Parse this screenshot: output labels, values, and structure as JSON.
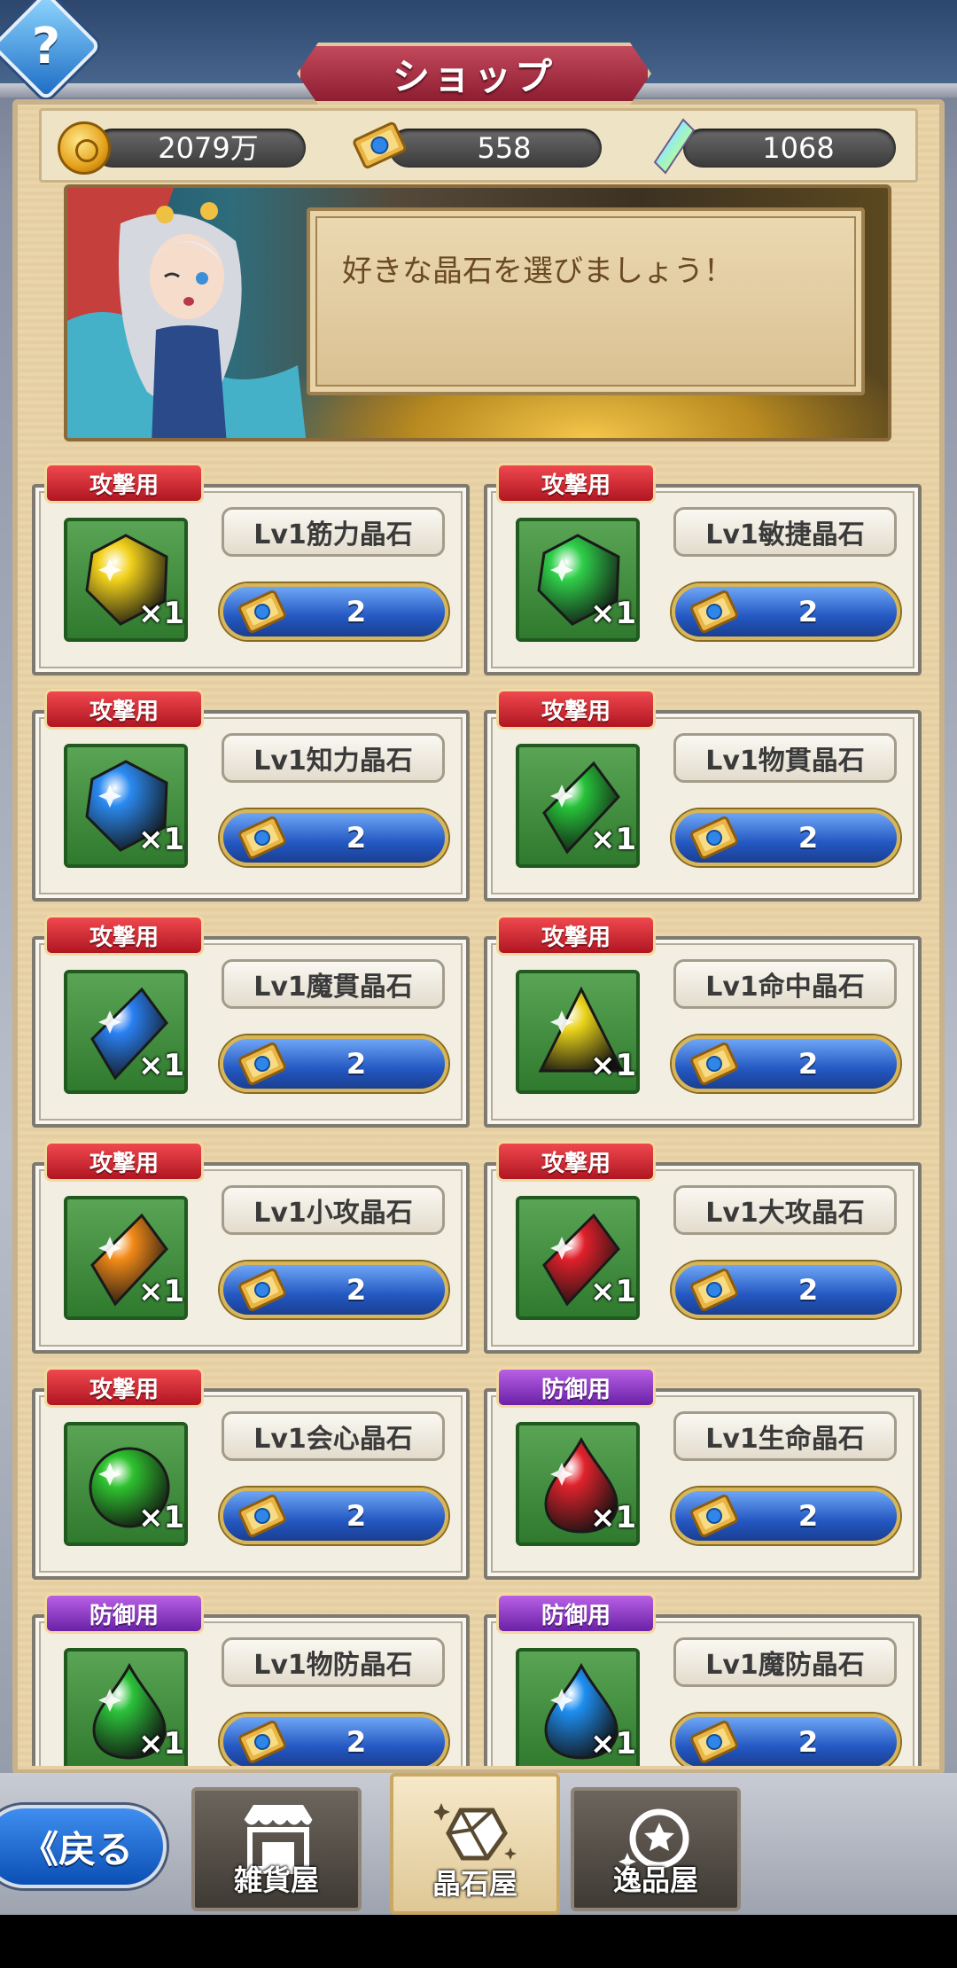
{
  "header": {
    "title": "ショップ",
    "help_glyph": "?"
  },
  "currency": {
    "gold": "2079万",
    "tickets": "558",
    "crystals": "1068"
  },
  "banner": {
    "message": "好きな晶石を選びましょう！"
  },
  "items": [
    {
      "category": "攻撃用",
      "type": "attack",
      "name": "Lv1筋力晶石",
      "qty": "×1",
      "price": "2",
      "gem_color": "#f2d21c",
      "gem_shape": "pentagon"
    },
    {
      "category": "攻撃用",
      "type": "attack",
      "name": "Lv1敏捷晶石",
      "qty": "×1",
      "price": "2",
      "gem_color": "#2fcf4a",
      "gem_shape": "pentagon"
    },
    {
      "category": "攻撃用",
      "type": "attack",
      "name": "Lv1知力晶石",
      "qty": "×1",
      "price": "2",
      "gem_color": "#2b8af0",
      "gem_shape": "pentagon"
    },
    {
      "category": "攻撃用",
      "type": "attack",
      "name": "Lv1物貫晶石",
      "qty": "×1",
      "price": "2",
      "gem_color": "#27c23a",
      "gem_shape": "rhombus"
    },
    {
      "category": "攻撃用",
      "type": "attack",
      "name": "Lv1魔貫晶石",
      "qty": "×1",
      "price": "2",
      "gem_color": "#2a80f2",
      "gem_shape": "rhombus"
    },
    {
      "category": "攻撃用",
      "type": "attack",
      "name": "Lv1命中晶石",
      "qty": "×1",
      "price": "2",
      "gem_color": "#e8d21a",
      "gem_shape": "triangle"
    },
    {
      "category": "攻撃用",
      "type": "attack",
      "name": "Lv1小攻晶石",
      "qty": "×1",
      "price": "2",
      "gem_color": "#f38a18",
      "gem_shape": "rhombus"
    },
    {
      "category": "攻撃用",
      "type": "attack",
      "name": "Lv1大攻晶石",
      "qty": "×1",
      "price": "2",
      "gem_color": "#e0202a",
      "gem_shape": "rhombus"
    },
    {
      "category": "攻撃用",
      "type": "attack",
      "name": "Lv1会心晶石",
      "qty": "×1",
      "price": "2",
      "gem_color": "#2fc22f",
      "gem_shape": "round"
    },
    {
      "category": "防御用",
      "type": "defense",
      "name": "Lv1生命晶石",
      "qty": "×1",
      "price": "2",
      "gem_color": "#e0232c",
      "gem_shape": "drop"
    },
    {
      "category": "防御用",
      "type": "defense",
      "name": "Lv1物防晶石",
      "qty": "×1",
      "price": "2",
      "gem_color": "#2cc23a",
      "gem_shape": "drop"
    },
    {
      "category": "防御用",
      "type": "defense",
      "name": "Lv1魔防晶石",
      "qty": "×1",
      "price": "2",
      "gem_color": "#1e8ef0",
      "gem_shape": "drop"
    }
  ],
  "nav": {
    "back": "戻る",
    "tabs": [
      {
        "label": "雑貨屋",
        "icon": "shop-icon",
        "active": false
      },
      {
        "label": "晶石屋",
        "icon": "crystal-icon",
        "active": true
      },
      {
        "label": "逸品屋",
        "icon": "star-ring-icon",
        "active": false
      }
    ]
  }
}
